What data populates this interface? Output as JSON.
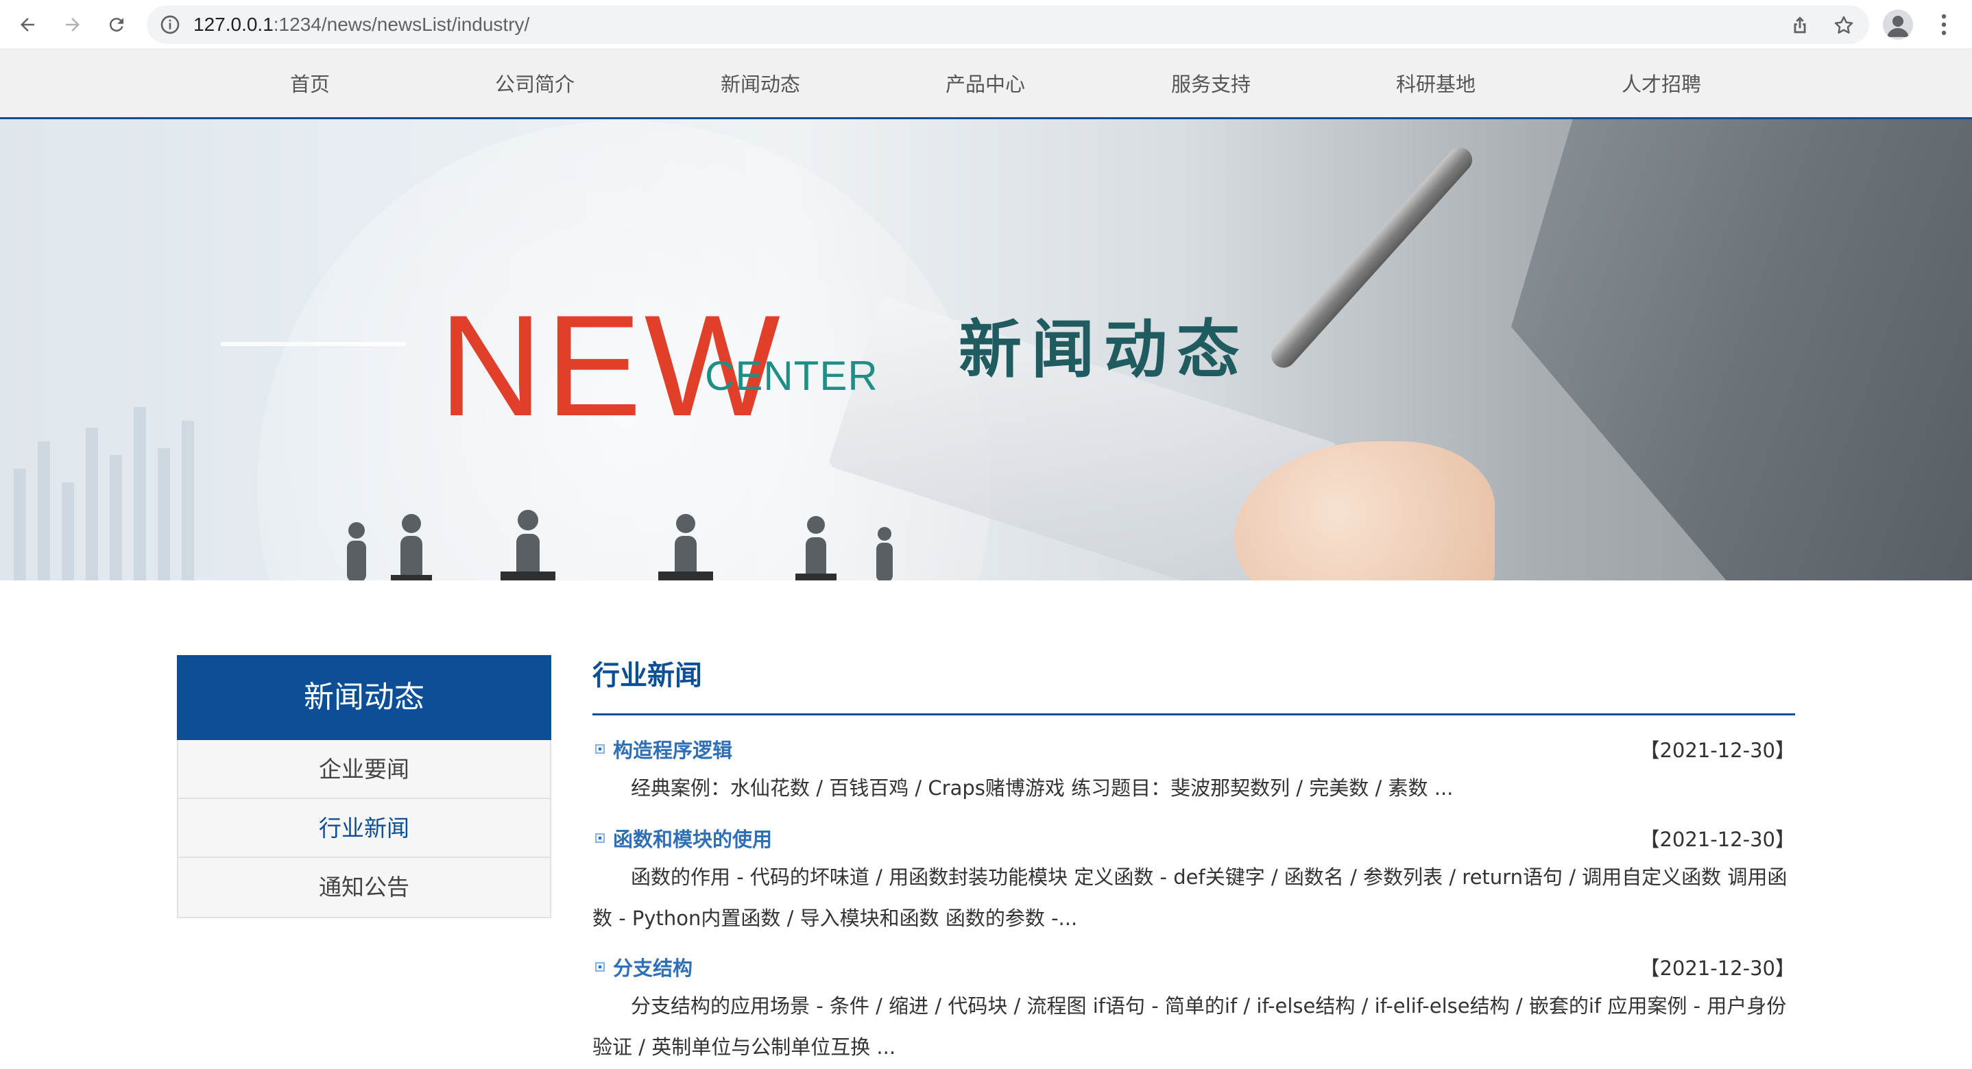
{
  "browser": {
    "url_host": "127.0.0.1",
    "url_path": ":1234/news/newsList/industry/"
  },
  "nav": {
    "items": [
      {
        "label": "首页"
      },
      {
        "label": "公司简介"
      },
      {
        "label": "新闻动态"
      },
      {
        "label": "产品中心"
      },
      {
        "label": "服务支持"
      },
      {
        "label": "科研基地"
      },
      {
        "label": "人才招聘"
      }
    ]
  },
  "banner": {
    "logo_new": "NEW",
    "logo_center": "CENTER",
    "title": "新闻动态"
  },
  "sidebar": {
    "heading": "新闻动态",
    "items": [
      {
        "label": "企业要闻"
      },
      {
        "label": "行业新闻",
        "active": true
      },
      {
        "label": "通知公告"
      }
    ]
  },
  "main": {
    "heading": "行业新闻",
    "news": [
      {
        "title": "构造程序逻辑",
        "date": "【2021-12-30】",
        "summary": "经典案例：水仙花数 / 百钱百鸡 / Craps赌博游戏 练习题目：斐波那契数列 / 完美数 / 素数 ..."
      },
      {
        "title": "函数和模块的使用",
        "date": "【2021-12-30】",
        "summary": "函数的作用 - 代码的坏味道 / 用函数封装功能模块 定义函数 - def关键字 / 函数名 / 参数列表 / return语句 / 调用自定义函数 调用函数 - Python内置函数 / 导入模块和函数 函数的参数 -..."
      },
      {
        "title": "分支结构",
        "date": "【2021-12-30】",
        "summary": "分支结构的应用场景 - 条件 / 缩进 / 代码块 / 流程图 if语句 - 简单的if / if-else结构 / if-elif-else结构 / 嵌套的if 应用案例 - 用户身份验证 / 英制单位与公制单位互换 ..."
      }
    ]
  }
}
